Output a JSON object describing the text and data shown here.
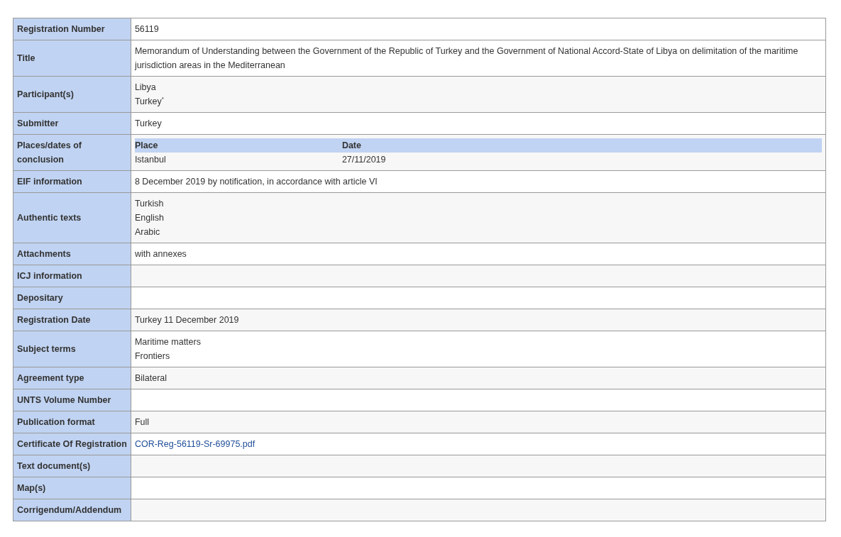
{
  "rows": [
    {
      "label": "Registration Number",
      "kind": "text",
      "lines": [
        "56119"
      ]
    },
    {
      "label": "Title",
      "kind": "text",
      "lines": [
        "Memorandum of Understanding between the Government of the Republic of Turkey and the Government of National Accord-State of Libya on delimitation of the maritime jurisdiction areas in the Mediterranean"
      ]
    },
    {
      "label": "Participant(s)",
      "kind": "text",
      "lines": [
        "Libya",
        "Turkey$^{*}$"
      ]
    },
    {
      "label": "Submitter",
      "kind": "text",
      "lines": [
        "Turkey"
      ]
    },
    {
      "label": "Places/dates of conclusion",
      "kind": "places",
      "columns": [
        "Place",
        "Date"
      ],
      "entries": [
        [
          "Istanbul",
          "27/11/2019"
        ]
      ]
    },
    {
      "label": "EIF information",
      "kind": "text",
      "lines": [
        "8 December 2019 by notification, in accordance with article VI"
      ]
    },
    {
      "label": "Authentic texts",
      "kind": "text",
      "lines": [
        "Turkish",
        "English",
        "Arabic"
      ]
    },
    {
      "label": "Attachments",
      "kind": "text",
      "lines": [
        "with annexes"
      ]
    },
    {
      "label": "ICJ information",
      "kind": "empty"
    },
    {
      "label": "Depositary",
      "kind": "empty"
    },
    {
      "label": "Registration Date",
      "kind": "text",
      "lines": [
        "Turkey 11 December 2019"
      ]
    },
    {
      "label": "Subject terms",
      "kind": "text",
      "lines": [
        "Maritime matters",
        "Frontiers"
      ]
    },
    {
      "label": "Agreement type",
      "kind": "text",
      "lines": [
        "Bilateral"
      ]
    },
    {
      "label": "UNTS Volume Number",
      "kind": "empty"
    },
    {
      "label": "Publication format",
      "kind": "text",
      "lines": [
        "Full"
      ]
    },
    {
      "label": "Certificate Of Registration",
      "kind": "link",
      "lines": [
        "COR-Reg-56119-Sr-69975.pdf"
      ]
    },
    {
      "label": "Text document(s)",
      "kind": "empty"
    },
    {
      "label": "Map(s)",
      "kind": "empty"
    },
    {
      "label": "Corrigendum/Addendum",
      "kind": "empty"
    }
  ]
}
